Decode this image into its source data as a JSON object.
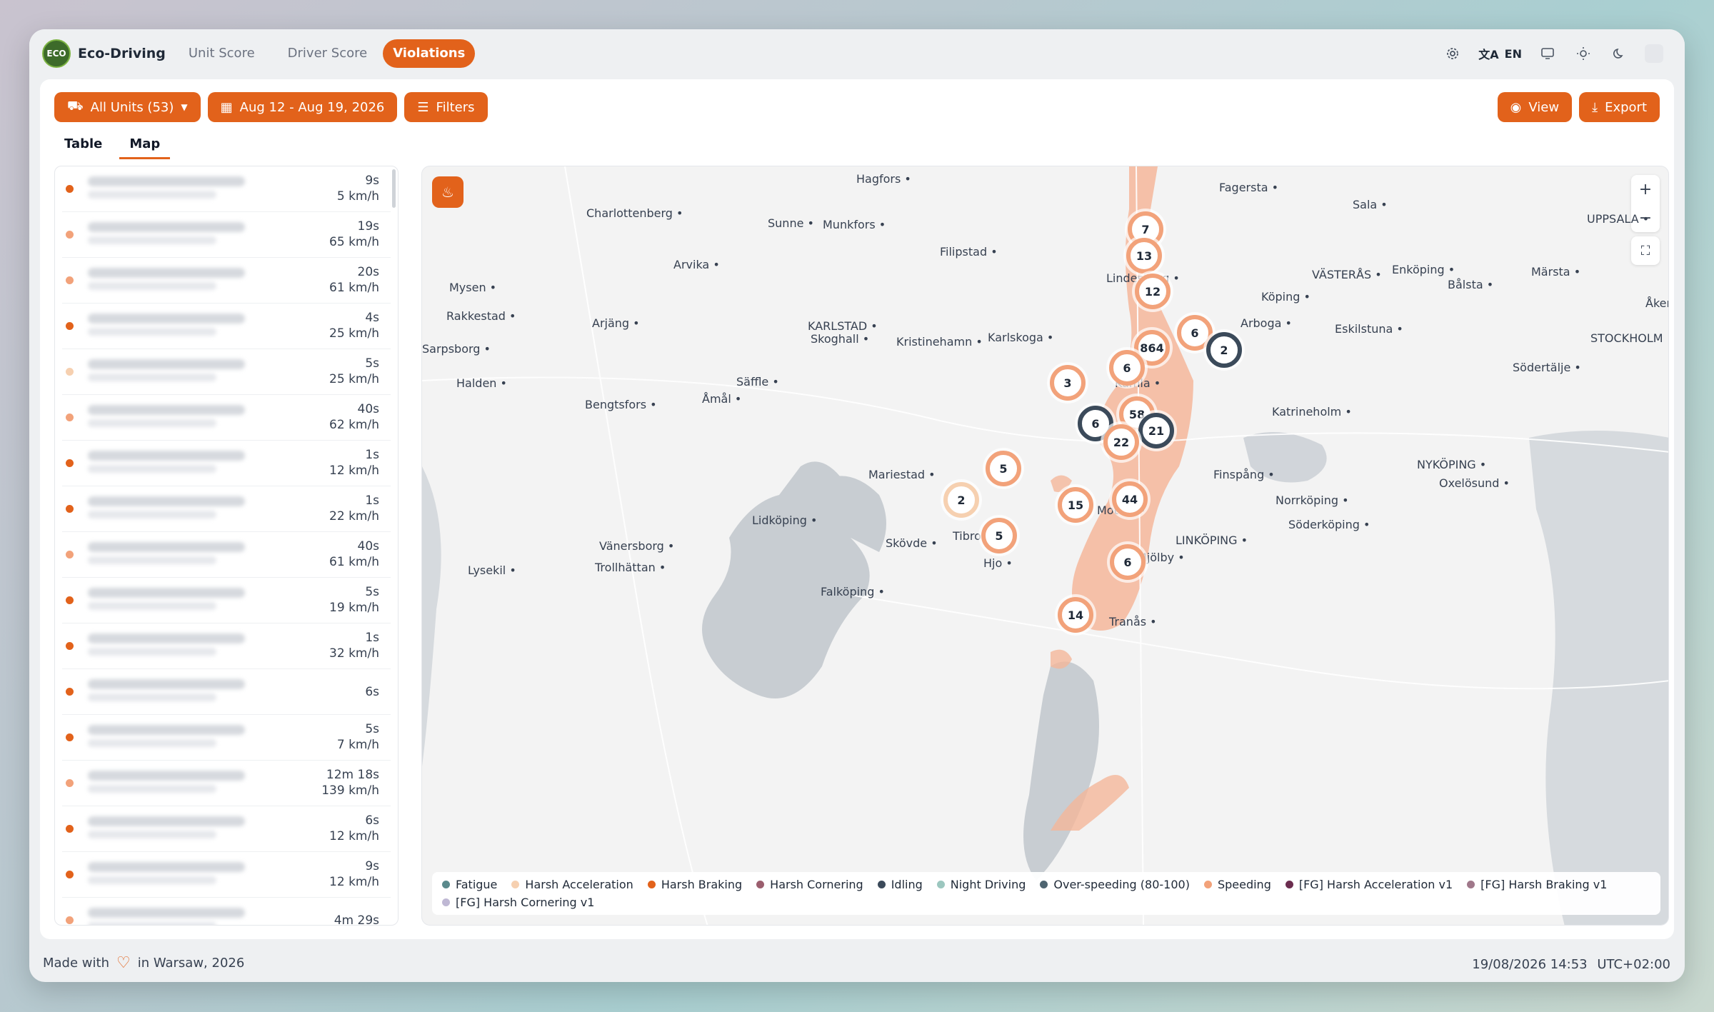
{
  "app": {
    "logo_text": "ECO",
    "title": "Eco-Driving",
    "tabs": [
      {
        "label": "Unit Score",
        "active": false
      },
      {
        "label": "Driver Score",
        "active": false
      },
      {
        "label": "Violations",
        "active": true
      }
    ],
    "language": "EN"
  },
  "toolbar": {
    "units_label": "All Units (53)",
    "date_range": "Aug 12 - Aug 19, 2026",
    "filters_label": "Filters",
    "view_label": "View",
    "export_label": "Export"
  },
  "subtabs": [
    {
      "label": "Table",
      "active": false
    },
    {
      "label": "Map",
      "active": true
    }
  ],
  "violations": [
    {
      "duration": "9s",
      "speed": "5 km/h",
      "color": "#e2621b"
    },
    {
      "duration": "19s",
      "speed": "65 km/h",
      "color": "#f2a27a"
    },
    {
      "duration": "20s",
      "speed": "61 km/h",
      "color": "#f2a27a"
    },
    {
      "duration": "4s",
      "speed": "25 km/h",
      "color": "#e2621b"
    },
    {
      "duration": "5s",
      "speed": "25 km/h",
      "color": "#f6d0b0"
    },
    {
      "duration": "40s",
      "speed": "62 km/h",
      "color": "#f2a27a"
    },
    {
      "duration": "1s",
      "speed": "12 km/h",
      "color": "#e2621b"
    },
    {
      "duration": "1s",
      "speed": "22 km/h",
      "color": "#e2621b"
    },
    {
      "duration": "40s",
      "speed": "61 km/h",
      "color": "#f2a27a"
    },
    {
      "duration": "5s",
      "speed": "19 km/h",
      "color": "#e2621b"
    },
    {
      "duration": "1s",
      "speed": "32 km/h",
      "color": "#e2621b"
    },
    {
      "duration": "6s",
      "speed": "",
      "color": "#e2621b"
    },
    {
      "duration": "5s",
      "speed": "7 km/h",
      "color": "#e2621b"
    },
    {
      "duration": "12m 18s",
      "speed": "139 km/h",
      "color": "#f2a27a"
    },
    {
      "duration": "6s",
      "speed": "12 km/h",
      "color": "#e2621b"
    },
    {
      "duration": "9s",
      "speed": "12 km/h",
      "color": "#e2621b"
    },
    {
      "duration": "4m 29s",
      "speed": "",
      "color": "#f2a27a"
    }
  ],
  "map": {
    "cities": [
      {
        "name": "Hagfors"
      },
      {
        "name": "Fagersta"
      },
      {
        "name": "Sala"
      },
      {
        "name": "Charlottenberg"
      },
      {
        "name": "Sunne"
      },
      {
        "name": "Munkfors"
      },
      {
        "name": "UPPSALA"
      },
      {
        "name": "Filipstad"
      },
      {
        "name": "Arvika"
      },
      {
        "name": "Lindesberg"
      },
      {
        "name": "VÄSTERÅS"
      },
      {
        "name": "Enköping"
      },
      {
        "name": "Märsta"
      },
      {
        "name": "Bålsta"
      },
      {
        "name": "Mysen"
      },
      {
        "name": "Köping"
      },
      {
        "name": "Rakkestad"
      },
      {
        "name": "Arjäng"
      },
      {
        "name": "KARLSTAD"
      },
      {
        "name": "Arboga"
      },
      {
        "name": "Eskilstuna"
      },
      {
        "name": "Åkers"
      },
      {
        "name": "Skoghall"
      },
      {
        "name": "Kristinehamn"
      },
      {
        "name": "Karlskoga"
      },
      {
        "name": "STOCKHOLM"
      },
      {
        "name": "Sarpsborg"
      },
      {
        "name": "Södertälje"
      },
      {
        "name": "Halden"
      },
      {
        "name": "Säffle"
      },
      {
        "name": "Kumla"
      },
      {
        "name": "Bengtsfors"
      },
      {
        "name": "Åmål"
      },
      {
        "name": "Katrineholm"
      },
      {
        "name": "Mariestad"
      },
      {
        "name": "Finspång"
      },
      {
        "name": "NYKÖPING"
      },
      {
        "name": "Oxelösund"
      },
      {
        "name": "Norrköping"
      },
      {
        "name": "Lidköping"
      },
      {
        "name": "Motala"
      },
      {
        "name": "Söderköping"
      },
      {
        "name": "Tibro"
      },
      {
        "name": "LINKÖPING"
      },
      {
        "name": "Vänersborg"
      },
      {
        "name": "Skövde"
      },
      {
        "name": "Lysekil"
      },
      {
        "name": "Trollhättan"
      },
      {
        "name": "Hjo"
      },
      {
        "name": "Mjölby"
      },
      {
        "name": "Falköping"
      },
      {
        "name": "Tranås"
      }
    ],
    "clusters": [
      {
        "count": "7",
        "ring": "#f2a27a"
      },
      {
        "count": "13",
        "ring": "#f2a27a"
      },
      {
        "count": "12",
        "ring": "#f2a27a"
      },
      {
        "count": "6",
        "ring": "#f2a27a"
      },
      {
        "count": "864",
        "ring": "#f2a27a"
      },
      {
        "count": "2",
        "ring": "#3b4a5a"
      },
      {
        "count": "6",
        "ring": "#f2a27a"
      },
      {
        "count": "3",
        "ring": "#f2a27a"
      },
      {
        "count": "58",
        "ring": "#f2a27a"
      },
      {
        "count": "6",
        "ring": "#3b4a5a"
      },
      {
        "count": "21",
        "ring": "#3b4a5a"
      },
      {
        "count": "22",
        "ring": "#f2a27a"
      },
      {
        "count": "5",
        "ring": "#f2a27a"
      },
      {
        "count": "2",
        "ring": "#f6d0b0"
      },
      {
        "count": "15",
        "ring": "#f2a27a"
      },
      {
        "count": "44",
        "ring": "#f2a27a"
      },
      {
        "count": "5",
        "ring": "#f2a27a"
      },
      {
        "count": "6",
        "ring": "#f2a27a"
      },
      {
        "count": "14",
        "ring": "#f2a27a"
      }
    ],
    "legend": [
      {
        "label": "Fatigue",
        "color": "#5b8a8c"
      },
      {
        "label": "Harsh Acceleration",
        "color": "#f6d0b0"
      },
      {
        "label": "Harsh Braking",
        "color": "#e2621b"
      },
      {
        "label": "Harsh Cornering",
        "color": "#9b5e6e"
      },
      {
        "label": "Idling",
        "color": "#3b4a5a"
      },
      {
        "label": "Night Driving",
        "color": "#9cc7bf"
      },
      {
        "label": "Over-speeding (80-100)",
        "color": "#4e6470"
      },
      {
        "label": "Speeding",
        "color": "#f2a27a"
      },
      {
        "label": "[FG] Harsh Acceleration v1",
        "color": "#6b2d4f"
      },
      {
        "label": "[FG] Harsh Braking v1",
        "color": "#a0788a"
      },
      {
        "label": "[FG] Harsh Cornering v1",
        "color": "#bfb8d4"
      }
    ]
  },
  "footer": {
    "made_with": "Made with",
    "in_place": "in Warsaw, 2026",
    "datetime": "19/08/2026 14:53",
    "timezone": "UTC+02:00"
  }
}
